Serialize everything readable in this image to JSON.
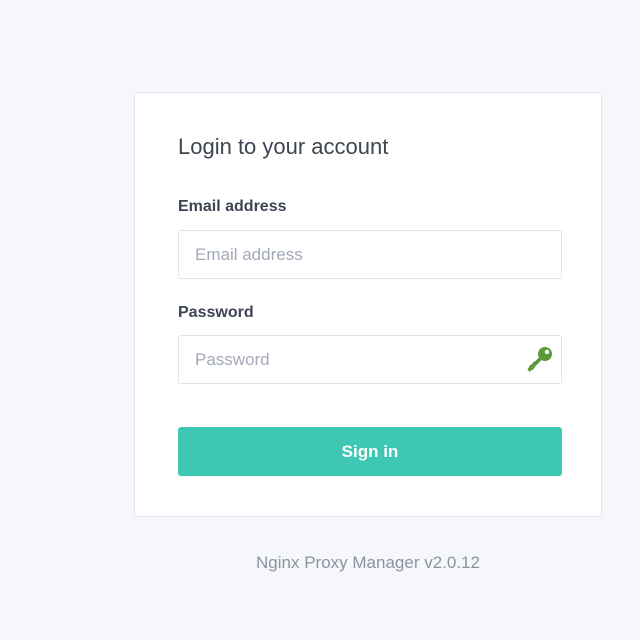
{
  "login_card": {
    "title": "Login to your account",
    "email": {
      "label": "Email address",
      "placeholder": "Email address",
      "value": ""
    },
    "password": {
      "label": "Password",
      "placeholder": "Password",
      "value": "",
      "icon": "key-icon",
      "icon_color": "#5a9a3a"
    },
    "submit_label": "Sign in"
  },
  "footer": {
    "version_text": "Nginx Proxy Manager v2.0.12"
  },
  "colors": {
    "accent": "#3ec8b4",
    "background": "#f5f7fb"
  }
}
